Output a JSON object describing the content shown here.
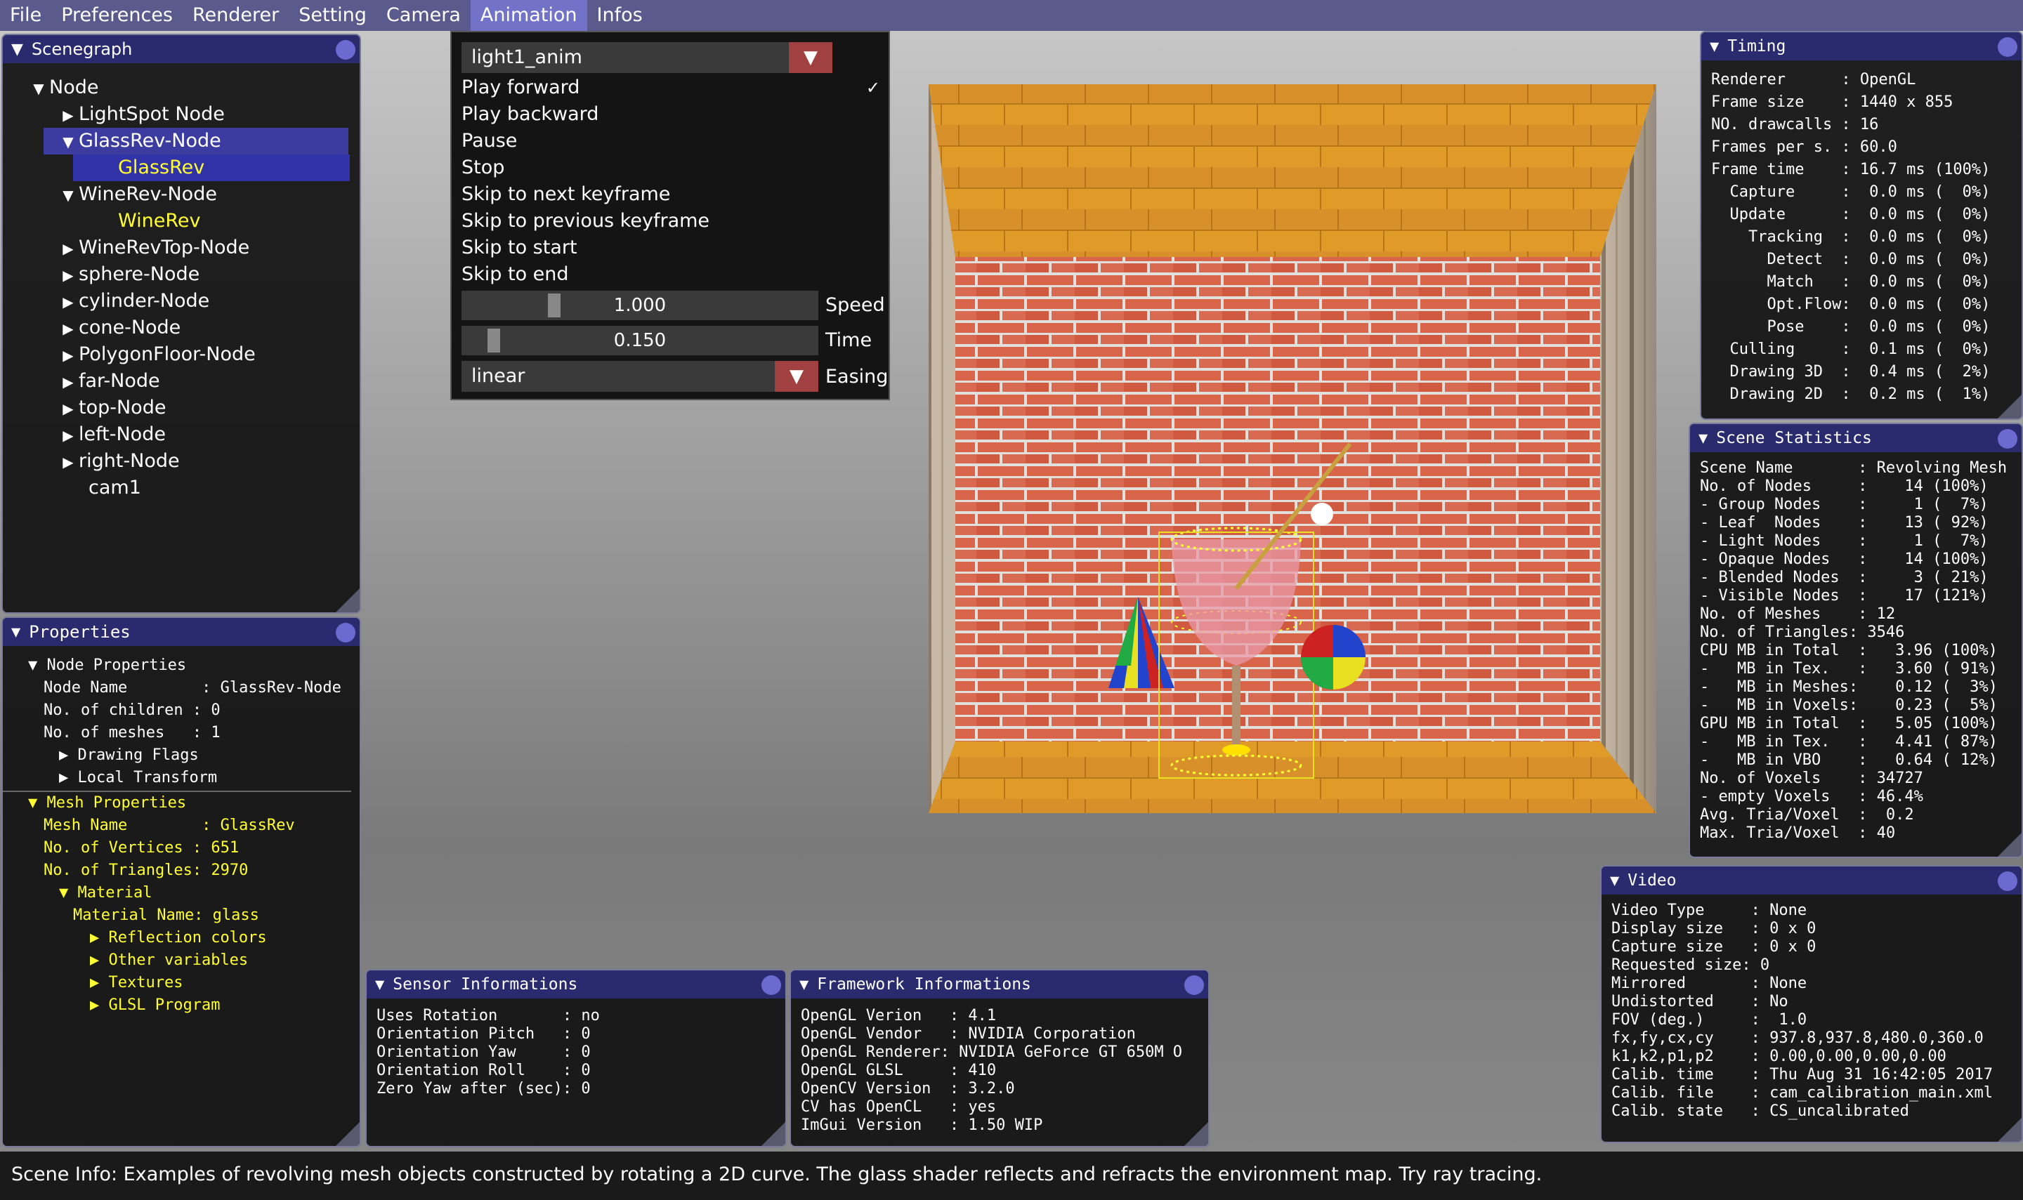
{
  "menubar": {
    "items": [
      "File",
      "Preferences",
      "Renderer",
      "Setting",
      "Camera",
      "Animation",
      "Infos"
    ],
    "active": "Animation"
  },
  "scenegraph": {
    "title": "Scenegraph",
    "root": "Node",
    "nodes": [
      "LightSpot Node",
      "GlassRev-Node",
      "GlassRev",
      "WineRev-Node",
      "WineRev",
      "WineRevTop-Node",
      "sphere-Node",
      "cylinder-Node",
      "cone-Node",
      "PolygonFloor-Node",
      "far-Node",
      "top-Node",
      "left-Node",
      "right-Node",
      "cam1"
    ]
  },
  "properties": {
    "title": "Properties",
    "node_props_label": "Node Properties",
    "node_name": "Node Name        : GlassRev-Node",
    "children": "No. of children : 0",
    "meshes": "No. of meshes   : 1",
    "drawing_flags": "Drawing Flags",
    "local_transform": "Local Transform",
    "mesh_props_label": "Mesh Properties",
    "mesh_name": "Mesh Name        : GlassRev",
    "vertices": "No. of Vertices : 651",
    "triangles": "No. of Triangles: 2970",
    "material": "Material",
    "material_name": "Material Name: glass",
    "reflection": "Reflection colors",
    "other": "Other variables",
    "textures": "Textures",
    "glsl": "GLSL Program"
  },
  "animation_menu": {
    "combo_value": "light1_anim",
    "items": [
      "Play forward",
      "Play backward",
      "Pause",
      "Stop",
      "Skip to next keyframe",
      "Skip to previous keyframe",
      "Skip to start",
      "Skip to end"
    ],
    "checked": "Play forward",
    "check_mark": "✓",
    "speed_value": "1.000",
    "speed_label": "Speed",
    "speed_fraction": 0.25,
    "time_value": "0.150",
    "time_label": "Time",
    "time_fraction": 0.05,
    "easing_value": "linear",
    "easing_label": "Easing"
  },
  "timing": {
    "title": "Timing",
    "lines": [
      "Renderer      : OpenGL",
      "Frame size    : 1440 x 855",
      "NO. drawcalls : 16",
      "Frames per s. : 60.0",
      "Frame time    : 16.7 ms (100%)",
      "  Capture     :  0.0 ms (  0%)",
      "  Update      :  0.0 ms (  0%)",
      "    Tracking  :  0.0 ms (  0%)",
      "      Detect  :  0.0 ms (  0%)",
      "      Match   :  0.0 ms (  0%)",
      "      Opt.Flow:  0.0 ms (  0%)",
      "      Pose    :  0.0 ms (  0%)",
      "  Culling     :  0.1 ms (  0%)",
      "  Drawing 3D  :  0.4 ms (  2%)",
      "  Drawing 2D  :  0.2 ms (  1%)"
    ]
  },
  "scene_stats": {
    "title": "Scene Statistics",
    "lines": [
      "Scene Name       : Revolving Mesh",
      "No. of Nodes     :    14 (100%)",
      "- Group Nodes    :     1 (  7%)",
      "- Leaf  Nodes    :    13 ( 92%)",
      "- Light Nodes    :     1 (  7%)",
      "- Opaque Nodes   :    14 (100%)",
      "- Blended Nodes  :     3 ( 21%)",
      "- Visible Nodes  :    17 (121%)",
      "No. of Meshes    : 12",
      "No. of Triangles: 3546",
      "CPU MB in Total  :   3.96 (100%)",
      "-   MB in Tex.   :   3.60 ( 91%)",
      "-   MB in Meshes:    0.12 (  3%)",
      "-   MB in Voxels:    0.23 (  5%)",
      "GPU MB in Total  :   5.05 (100%)",
      "-   MB in Tex.   :   4.41 ( 87%)",
      "-   MB in VBO    :   0.64 ( 12%)",
      "No. of Voxels    : 34727",
      "- empty Voxels   : 46.4%",
      "Avg. Tria/Voxel  :  0.2",
      "Max. Tria/Voxel  : 40"
    ]
  },
  "video": {
    "title": "Video",
    "lines": [
      "Video Type     : None",
      "Display size   : 0 x 0",
      "Capture size   : 0 x 0",
      "Requested size: 0",
      "Mirrored       : None",
      "Undistorted    : No",
      "FOV (deg.)     :  1.0",
      "fx,fy,cx,cy    : 937.8,937.8,480.0,360.0",
      "k1,k2,p1,p2    : 0.00,0.00,0.00,0.00",
      "Calib. time    : Thu Aug 31 16:42:05 2017",
      "Calib. file    : cam_calibration_main.xml",
      "Calib. state   : CS_uncalibrated"
    ]
  },
  "sensor": {
    "title": "Sensor Informations",
    "lines": [
      "Uses Rotation       : no",
      "Orientation Pitch   : 0",
      "Orientation Yaw     : 0",
      "Orientation Roll    : 0",
      "Zero Yaw after (sec): 0"
    ]
  },
  "framework": {
    "title": "Framework Informations",
    "lines": [
      "OpenGL Verion   : 4.1",
      "OpenGL Vendor   : NVIDIA Corporation",
      "OpenGL Renderer: NVIDIA GeForce GT 650M O",
      "OpenGL GLSL     : 410",
      "OpenCV Version  : 3.2.0",
      "CV has OpenCL   : yes",
      "ImGui Version   : 1.50 WIP"
    ]
  },
  "status": {
    "text": "Scene Info: Examples of revolving mesh objects constructed by rotating a 2D curve. The glass shader reflects and refracts the environment map. Try ray tracing."
  }
}
